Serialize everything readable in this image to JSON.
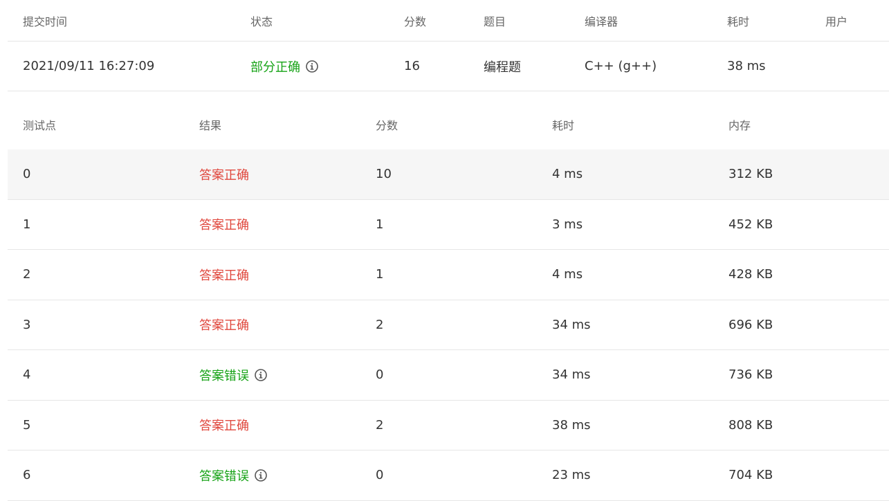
{
  "submission": {
    "headers": {
      "time": "提交时间",
      "status": "状态",
      "score": "分数",
      "problem": "题目",
      "compiler": "编译器",
      "elapsed": "耗时",
      "user": "用户"
    },
    "row": {
      "time": "2021/09/11 16:27:09",
      "status": "部分正确",
      "score": "16",
      "problem": "编程题",
      "compiler": "C++ (g++)",
      "elapsed": "38 ms",
      "user": ""
    }
  },
  "testcases": {
    "headers": {
      "case": "测试点",
      "result": "结果",
      "score": "分数",
      "elapsed": "耗时",
      "memory": "内存"
    },
    "rows": [
      {
        "case": "0",
        "result": "答案正确",
        "score": "10",
        "elapsed": "4 ms",
        "memory": "312 KB"
      },
      {
        "case": "1",
        "result": "答案正确",
        "score": "1",
        "elapsed": "3 ms",
        "memory": "452 KB"
      },
      {
        "case": "2",
        "result": "答案正确",
        "score": "1",
        "elapsed": "4 ms",
        "memory": "428 KB"
      },
      {
        "case": "3",
        "result": "答案正确",
        "score": "2",
        "elapsed": "34 ms",
        "memory": "696 KB"
      },
      {
        "case": "4",
        "result": "答案错误",
        "score": "0",
        "elapsed": "34 ms",
        "memory": "736 KB"
      },
      {
        "case": "5",
        "result": "答案正确",
        "score": "2",
        "elapsed": "38 ms",
        "memory": "808 KB"
      },
      {
        "case": "6",
        "result": "答案错误",
        "score": "0",
        "elapsed": "23 ms",
        "memory": "704 KB"
      }
    ]
  },
  "colors": {
    "correct": "#e0473d",
    "wrong": "#17a317",
    "partial": "#17a317",
    "header_text": "#666666",
    "body_text": "#333333",
    "divider": "#e6e6e6",
    "row_highlight": "#f6f6f6"
  },
  "icons": {
    "info": "info-circle-icon"
  }
}
